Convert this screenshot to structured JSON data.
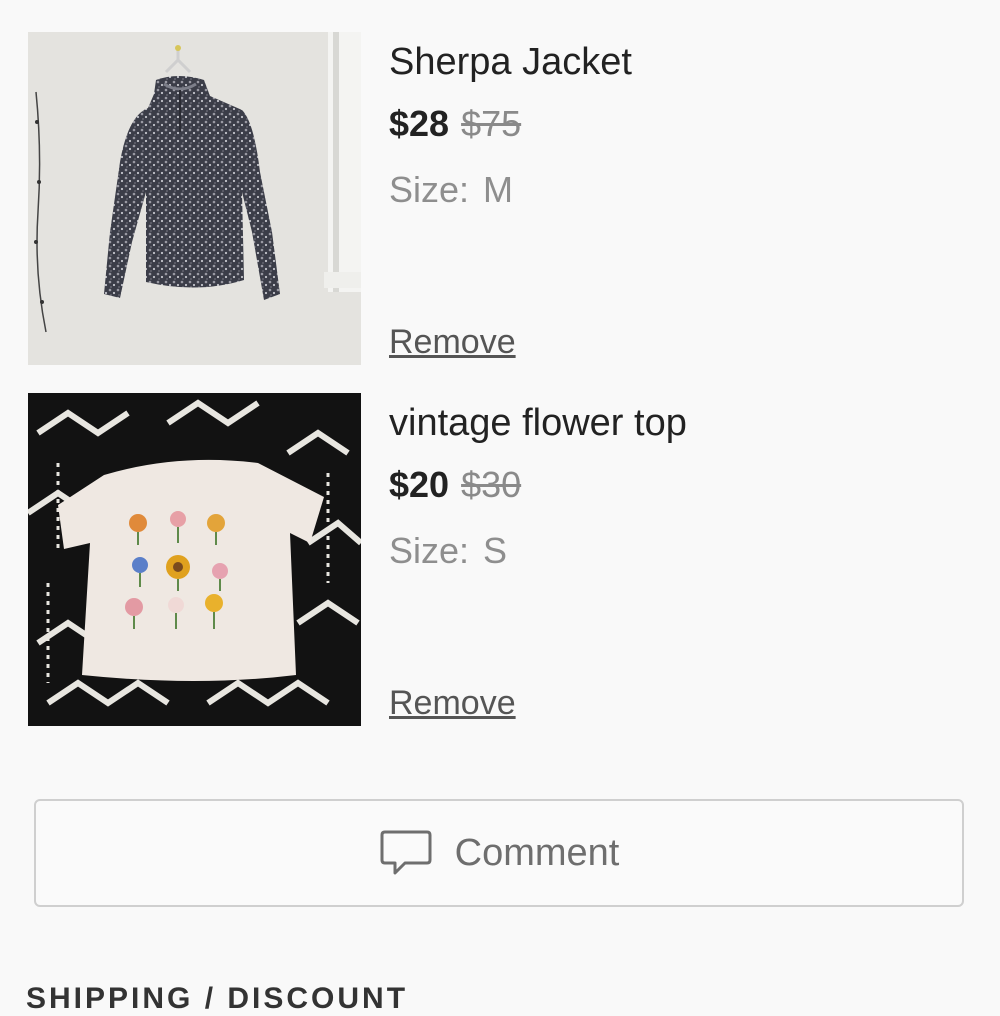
{
  "cart": {
    "items": [
      {
        "title": "Sherpa Jacket",
        "price": "$28",
        "original_price": "$75",
        "size_label": "Size:",
        "size_value": "M",
        "remove_label": "Remove",
        "image": "gray-fleece-pullover-photo"
      },
      {
        "title": "vintage flower top",
        "price": "$20",
        "original_price": "$30",
        "size_label": "Size:",
        "size_value": "S",
        "remove_label": "Remove",
        "image": "floral-print-tee-photo"
      }
    ]
  },
  "comment": {
    "label": "Comment",
    "icon": "speech-bubble-icon"
  },
  "section": {
    "heading": "SHIPPING / DISCOUNT"
  },
  "colors": {
    "background": "#f9f9f9",
    "text": "#222222",
    "muted": "#8a8a8a",
    "border": "#cfcfcf"
  }
}
